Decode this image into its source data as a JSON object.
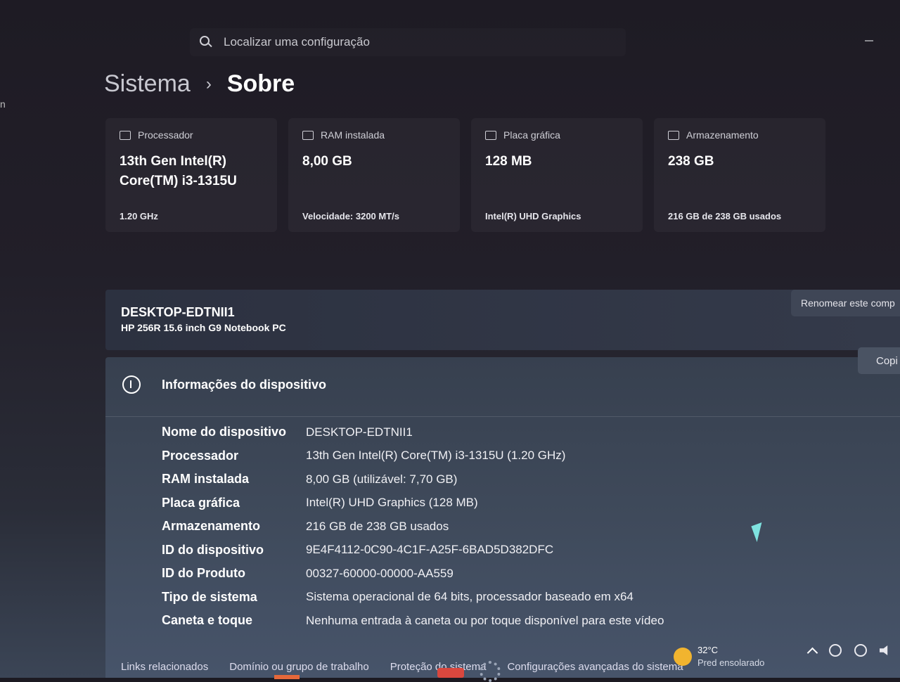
{
  "window": {
    "edge_text": "n"
  },
  "search": {
    "placeholder": "Localizar uma configuração"
  },
  "breadcrumb": {
    "parent": "Sistema",
    "separator": "›",
    "current": "Sobre"
  },
  "cards": [
    {
      "icon": "processor-icon",
      "label": "Processador",
      "value": "13th Gen Intel(R) Core(TM) i3-1315U",
      "sub": "1.20 GHz"
    },
    {
      "icon": "ram-icon",
      "label": "RAM instalada",
      "value": "8,00 GB",
      "sub": "Velocidade: 3200 MT/s"
    },
    {
      "icon": "graphics-card-icon",
      "label": "Placa gráfica",
      "value": "128 MB",
      "sub": "Intel(R) UHD Graphics"
    },
    {
      "icon": "storage-icon",
      "label": "Armazenamento",
      "value": "238 GB",
      "sub": "216 GB de 238 GB usados"
    }
  ],
  "device": {
    "name": "DESKTOP-EDTNII1",
    "model": "HP 256R 15.6 inch G9 Notebook PC",
    "rename_label": "Renomear este comp"
  },
  "info": {
    "icon": "info-icon",
    "title": "Informações do dispositivo",
    "copy_label": "Copi",
    "rows": [
      {
        "label": "Nome do dispositivo",
        "value": "DESKTOP-EDTNII1"
      },
      {
        "label": "Processador",
        "value": "13th Gen Intel(R) Core(TM) i3-1315U (1.20 GHz)"
      },
      {
        "label": "RAM instalada",
        "value": "8,00 GB (utilizável: 7,70 GB)"
      },
      {
        "label": "Placa gráfica",
        "value": "Intel(R) UHD Graphics (128 MB)"
      },
      {
        "label": "Armazenamento",
        "value": "216 GB de 238 GB usados"
      },
      {
        "label": "ID do dispositivo",
        "value": "9E4F4112-0C90-4C1F-A25F-6BAD5D382DFC"
      },
      {
        "label": "ID do Produto",
        "value": "00327-60000-00000-AA559"
      },
      {
        "label": "Tipo de sistema",
        "value": "Sistema operacional de 64 bits, processador baseado em x64"
      },
      {
        "label": "Caneta e toque",
        "value": "Nenhuma entrada à caneta ou por toque disponível para este vídeo"
      }
    ],
    "related": {
      "label": "Links relacionados",
      "links": [
        "Domínio ou grupo de trabalho",
        "Proteção do sistema",
        "Configurações avançadas do sistema"
      ]
    }
  },
  "taskbar": {
    "temperature": "32°C",
    "weather": "Pred ensolarado"
  },
  "colors": {
    "accent_weather": "#f1b42f",
    "cursor": "#7fe3e0"
  }
}
